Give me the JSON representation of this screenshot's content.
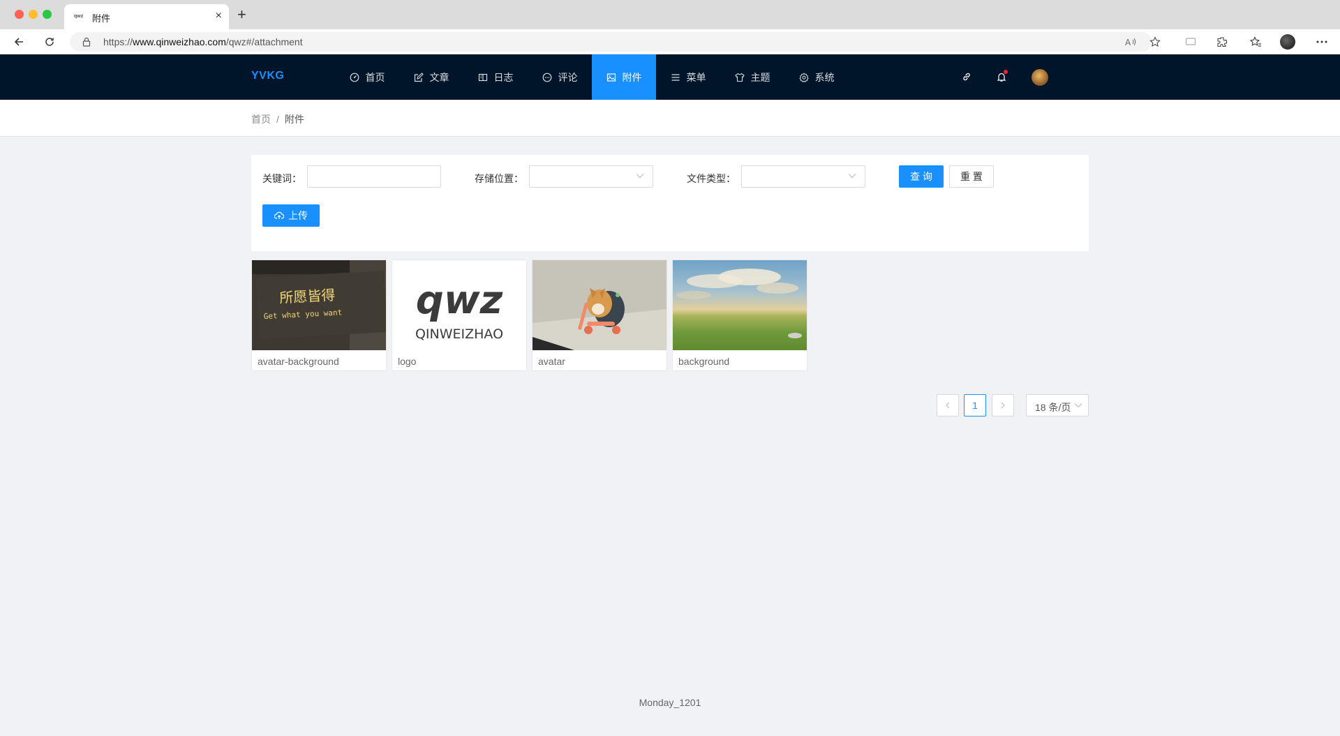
{
  "browser": {
    "tab_title": "附件",
    "favicon_text": "qwz",
    "url_prefix": "https://",
    "url_host": "www.qinweizhao.com",
    "url_path": "/qwz#/attachment"
  },
  "header": {
    "brand": "YVKG",
    "menu": [
      {
        "label": "首页",
        "icon": "dashboard-icon",
        "active": false
      },
      {
        "label": "文章",
        "icon": "edit-icon",
        "active": false
      },
      {
        "label": "日志",
        "icon": "book-icon",
        "active": false
      },
      {
        "label": "评论",
        "icon": "message-icon",
        "active": false
      },
      {
        "label": "附件",
        "icon": "picture-icon",
        "active": true
      },
      {
        "label": "菜单",
        "icon": "bars-icon",
        "active": false
      },
      {
        "label": "主题",
        "icon": "skin-icon",
        "active": false
      },
      {
        "label": "系统",
        "icon": "setting-icon",
        "active": false
      }
    ],
    "accent_color": "#1890ff",
    "background_color": "#001529"
  },
  "breadcrumb": {
    "home": "首页",
    "separator": "/",
    "current": "附件"
  },
  "filters": {
    "keyword_label": "关键词：",
    "keyword_value": "",
    "storage_label": "存储位置：",
    "storage_value": "",
    "filetype_label": "文件类型：",
    "filetype_value": "",
    "query_button": "查 询",
    "reset_button": "重 置",
    "upload_button": "上传"
  },
  "attachments": [
    {
      "name": "avatar-background",
      "sign_cn": "所愿皆得",
      "sign_en": "Get what you want"
    },
    {
      "name": "logo",
      "logo_mark": "qwz",
      "logo_text": "QINWEIZHAO"
    },
    {
      "name": "avatar"
    },
    {
      "name": "background"
    }
  ],
  "pagination": {
    "prev": "<",
    "current_page": "1",
    "next": ">",
    "page_size": "18 条/页"
  },
  "footer": {
    "text": "Monday_1201"
  }
}
